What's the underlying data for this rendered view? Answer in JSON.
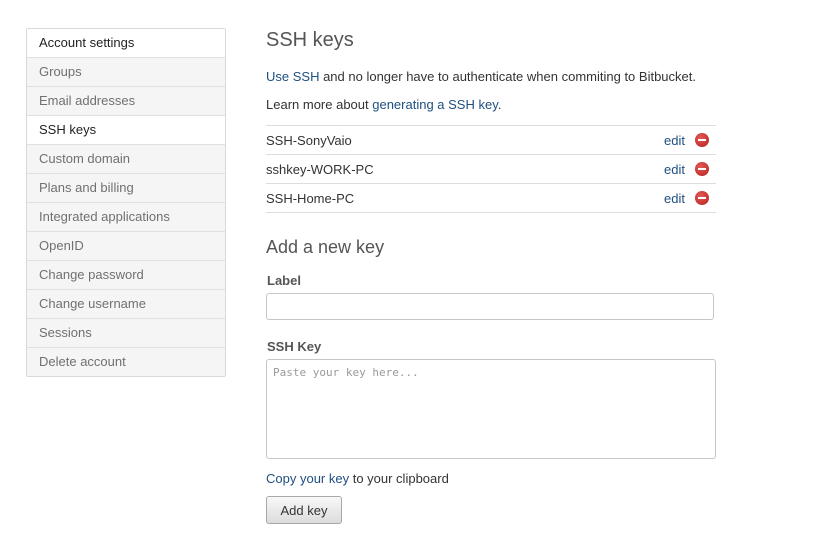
{
  "sidebar": {
    "items": [
      {
        "label": "Account settings"
      },
      {
        "label": "Groups"
      },
      {
        "label": "Email addresses"
      },
      {
        "label": "SSH keys"
      },
      {
        "label": "Custom domain"
      },
      {
        "label": "Plans and billing"
      },
      {
        "label": "Integrated applications"
      },
      {
        "label": "OpenID"
      },
      {
        "label": "Change password"
      },
      {
        "label": "Change username"
      },
      {
        "label": "Sessions"
      },
      {
        "label": "Delete account"
      }
    ]
  },
  "main": {
    "title": "SSH keys",
    "intro1": {
      "link": "Use SSH",
      "text": " and no longer have to authenticate when commiting to Bitbucket."
    },
    "intro2": {
      "text": "Learn more about ",
      "link": "generating a SSH key",
      "suffix": "."
    },
    "keys": [
      {
        "name": "SSH-SonyVaio",
        "edit": "edit",
        "delete_icon": "minus-circle-icon"
      },
      {
        "name": "sshkey-WORK-PC",
        "edit": "edit",
        "delete_icon": "minus-circle-icon"
      },
      {
        "name": "SSH-Home-PC",
        "edit": "edit",
        "delete_icon": "minus-circle-icon"
      }
    ],
    "add_section": {
      "title": "Add a new key",
      "label_field": {
        "label": "Label",
        "value": ""
      },
      "ssh_key_field": {
        "label": "SSH Key",
        "placeholder": "Paste your key here...",
        "value": ""
      },
      "copy_link": "Copy your key",
      "copy_text": " to your clipboard",
      "button_label": "Add key"
    }
  },
  "colors": {
    "link": "#205081",
    "delete": "#c8302c",
    "sidebar_bg": "#f5f5f5",
    "sidebar_active_bg": "#ffffff"
  }
}
